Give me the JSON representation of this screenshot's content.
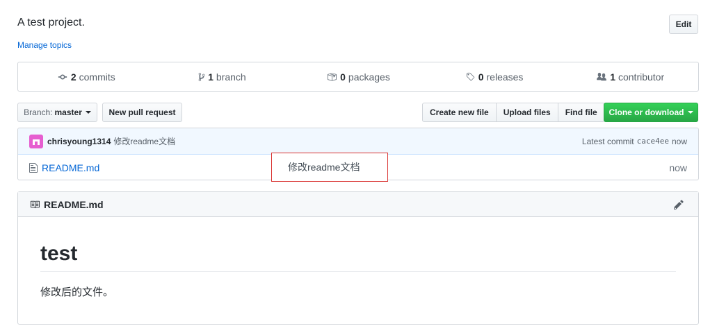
{
  "repo": {
    "description": "A test project.",
    "manage_topics": "Manage topics",
    "edit_label": "Edit"
  },
  "summary": [
    {
      "icon": "commit-icon",
      "count": "2",
      "label": "commits"
    },
    {
      "icon": "branch-icon",
      "count": "1",
      "label": "branch"
    },
    {
      "icon": "package-icon",
      "count": "0",
      "label": "packages"
    },
    {
      "icon": "tag-icon",
      "count": "0",
      "label": "releases"
    },
    {
      "icon": "people-icon",
      "count": "1",
      "label": "contributor"
    }
  ],
  "toolbar": {
    "branch_label": "Branch:",
    "branch_value": "master",
    "new_pull_request": "New pull request",
    "create_new_file": "Create new file",
    "upload_files": "Upload files",
    "find_file": "Find file",
    "clone_or_download": "Clone or download"
  },
  "latest_commit": {
    "author": "chrisyoung1314",
    "message": "修改readme文档",
    "latest_label": "Latest commit",
    "sha": "cace4ee",
    "age": "now"
  },
  "files": [
    {
      "name": "README.md",
      "commit_message": "修改readme文档",
      "age": "now"
    }
  ],
  "readme": {
    "header": "README.md",
    "heading": "test",
    "paragraph": "修改后的文件。"
  },
  "colors": {
    "link": "#0366d6",
    "clone_button": "#28a745",
    "commit_bar": "#f1f8ff",
    "highlight_border": "#d9302e"
  }
}
